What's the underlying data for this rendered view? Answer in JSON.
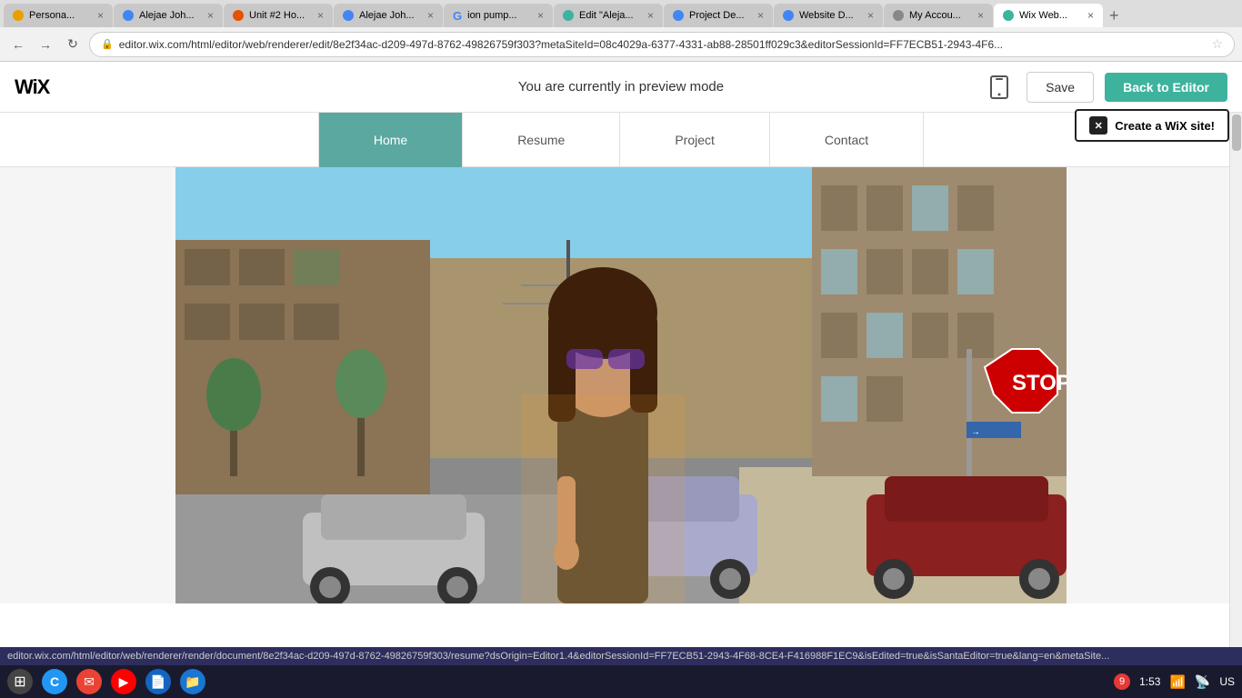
{
  "browser": {
    "tabs": [
      {
        "id": "tab1",
        "label": "Persona...",
        "active": false,
        "color": "#e8a000",
        "icon": "👤"
      },
      {
        "id": "tab2",
        "label": "Alejae Joh...",
        "active": false,
        "color": "#4285f4",
        "icon": "📄"
      },
      {
        "id": "tab3",
        "label": "Unit #2 Ho...",
        "active": false,
        "color": "#e65100",
        "icon": "🔵"
      },
      {
        "id": "tab4",
        "label": "Alejae Joh...",
        "active": false,
        "color": "#4285f4",
        "icon": "📄"
      },
      {
        "id": "tab5",
        "label": "ion pump...",
        "active": false,
        "color": "#fff",
        "icon": "G"
      },
      {
        "id": "tab6",
        "label": "Edit \"Aleja...",
        "active": false,
        "color": "#3db39e",
        "icon": "✏"
      },
      {
        "id": "tab7",
        "label": "Project De...",
        "active": false,
        "color": "#4285f4",
        "icon": "📋"
      },
      {
        "id": "tab8",
        "label": "Website D...",
        "active": false,
        "color": "#4285f4",
        "icon": "🌐"
      },
      {
        "id": "tab9",
        "label": "My Accou...",
        "active": false,
        "color": "#888",
        "icon": "👤"
      },
      {
        "id": "tab10",
        "label": "Wix Web...",
        "active": true,
        "color": "#3db39e",
        "icon": "W"
      }
    ],
    "url": "editor.wix.com/html/editor/web/renderer/edit/8e2f34ac-d209-497d-8762-49826759f303?metaSiteId=08c4029a-6377-4331-ab88-28501ff029c3&editorSessionId=FF7ECB51-2943-4F6..."
  },
  "wix_bar": {
    "logo": "WiX",
    "preview_text": "You are currently in preview mode",
    "save_label": "Save",
    "back_to_editor_label": "Back to Editor"
  },
  "create_wix_banner": {
    "label": "✕ Create a WiX site!"
  },
  "nav": {
    "items": [
      "Home",
      "Resume",
      "Project",
      "Contact"
    ],
    "active": "Home"
  },
  "hero": {
    "alt": "Person standing on street wearing sunglasses"
  },
  "taskbar": {
    "icons": [
      "⬤",
      "🌐",
      "✉",
      "▶",
      "📄",
      "📁"
    ],
    "badge": "9",
    "time": "1:53",
    "locale": "US"
  },
  "status_bar": {
    "url": "editor.wix.com/html/editor/web/renderer/render/document/8e2f34ac-d209-497d-8762-49826759f303/resume?dsOrigin=Editor1.4&editorSessionId=FF7ECB51-2943-4F68-8CE4-F416988F1EC9&isEdited=true&isSantaEditor=true&lang=en&metaSite..."
  }
}
